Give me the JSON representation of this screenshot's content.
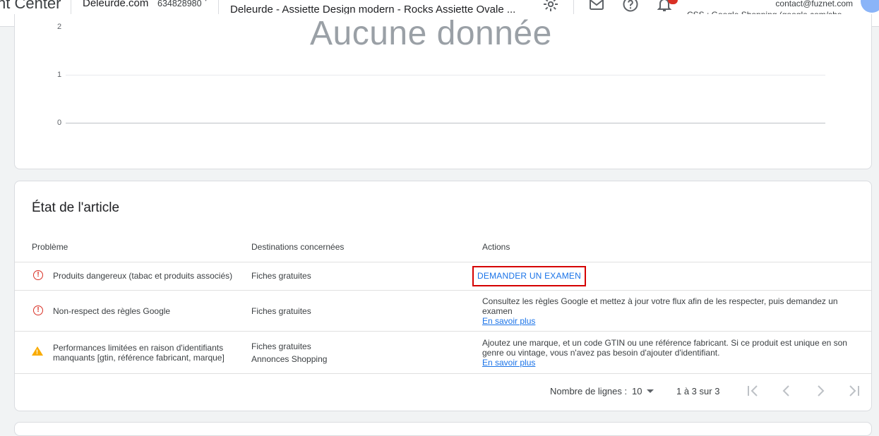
{
  "topbar": {
    "brand": "nt Center",
    "account_name": "Deleurde.com",
    "account_id": "634828980",
    "product_title": "Deleurde - Assiette Design modern - Rocks Assiette Ovale ...",
    "user_email": "contact@fuznet.com",
    "css_label": "CSS : Google Shopping (google.com/shop..."
  },
  "chart": {
    "no_data_label": "Aucune donnée",
    "yticks": [
      "2",
      "1",
      "0"
    ]
  },
  "item_status": {
    "title": "État de l'article",
    "columns": [
      "Problème",
      "Destinations concernées",
      "Actions"
    ],
    "rows": [
      {
        "icon": "error-icon",
        "problem": "Produits dangereux (tabac et produits associés)",
        "destinations": [
          "Fiches gratuites"
        ],
        "action_button": "DEMANDER UN EXAMEN"
      },
      {
        "icon": "error-icon",
        "problem": "Non-respect des règles Google",
        "destinations": [
          "Fiches gratuites"
        ],
        "action_text": "Consultez les règles Google et mettez à jour votre flux afin de les respecter, puis demandez un examen",
        "action_link": "En savoir plus"
      },
      {
        "icon": "warning-icon",
        "problem": "Performances limitées en raison d'identifiants manquants [gtin, référence fabricant, marque]",
        "destinations": [
          "Fiches gratuites",
          "Annonces Shopping"
        ],
        "action_text": "Ajoutez une marque, et un code GTIN ou une référence fabricant. Si ce produit est unique en son genre ou vintage, vous n'avez pas besoin d'ajouter d'identifiant.",
        "action_link": "En savoir plus"
      }
    ],
    "pagination": {
      "rows_label": "Nombre de lignes :",
      "rows_value": "10",
      "range": "1 à 3 sur 3"
    }
  },
  "colors": {
    "error": "#d93025",
    "warning": "#f9ab00",
    "link": "#1a73e8",
    "highlight_box": "#d50000"
  }
}
